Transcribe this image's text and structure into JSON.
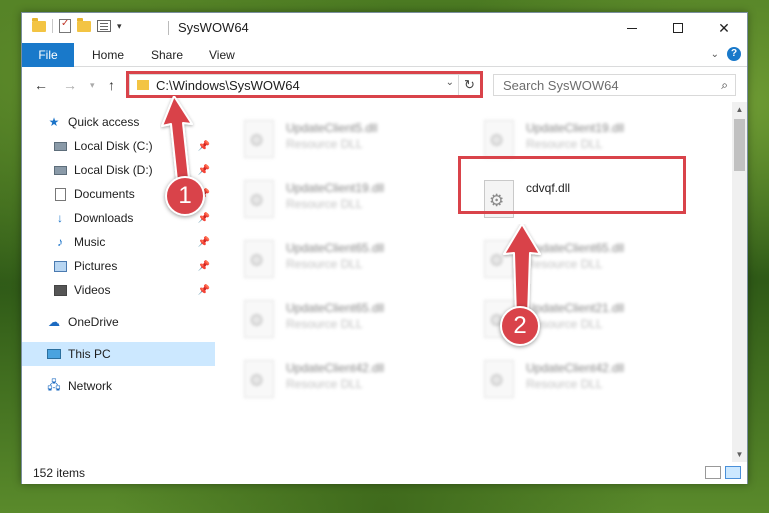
{
  "window": {
    "title": "SysWOW64",
    "controls": {
      "minimize": "",
      "maximize": "",
      "close": "✕"
    }
  },
  "ribbon": {
    "tabs": [
      {
        "label": "File"
      },
      {
        "label": "Home"
      },
      {
        "label": "Share"
      },
      {
        "label": "View"
      }
    ],
    "help_label": "?"
  },
  "address_bar": {
    "path": "C:\\Windows\\SysWOW64",
    "refresh_icon": "↻"
  },
  "search": {
    "placeholder": "Search SysWOW64"
  },
  "nav_pane": {
    "items": [
      {
        "label": "Quick access",
        "icon": "star-icon",
        "pinned": false
      },
      {
        "label": "Local Disk (C:)",
        "icon": "drive-icon",
        "pinned": true
      },
      {
        "label": "Local Disk (D:)",
        "icon": "drive-icon",
        "pinned": true
      },
      {
        "label": "Documents",
        "icon": "documents-icon",
        "pinned": true
      },
      {
        "label": "Downloads",
        "icon": "download-icon",
        "pinned": true
      },
      {
        "label": "Music",
        "icon": "music-icon",
        "pinned": true
      },
      {
        "label": "Pictures",
        "icon": "pictures-icon",
        "pinned": true
      },
      {
        "label": "Videos",
        "icon": "videos-icon",
        "pinned": true
      },
      {
        "label": "OneDrive",
        "icon": "cloud-icon",
        "pinned": false
      },
      {
        "label": "This PC",
        "icon": "pc-icon",
        "pinned": false,
        "selected": true
      },
      {
        "label": "Network",
        "icon": "network-icon",
        "pinned": false
      }
    ]
  },
  "files": [
    {
      "name": "UpdateClient5.dll",
      "type": "Resource DLL"
    },
    {
      "name": "UpdateClient19.dll",
      "type": "Resource DLL"
    },
    {
      "name": "UpdateClient19.dll",
      "type": "Resource DLL"
    },
    {
      "name": "cdvqf.dll",
      "type": ""
    },
    {
      "name": "UpdateClient65.dll",
      "type": "Resource DLL"
    },
    {
      "name": "UpdateClient65.dll",
      "type": "Resource DLL"
    },
    {
      "name": "UpdateClient65.dll",
      "type": "Resource DLL"
    },
    {
      "name": "UpdateClient21.dll",
      "type": "Resource DLL"
    },
    {
      "name": "UpdateClient42.dll",
      "type": "Resource DLL"
    },
    {
      "name": "UpdateClient42.dll",
      "type": "Resource DLL"
    }
  ],
  "status_bar": {
    "item_count": "152 items"
  },
  "annotations": {
    "step1": "1",
    "step2": "2",
    "accent_color": "#d9434a"
  },
  "colors": {
    "file_tab": "#1979ca",
    "selected_nav": "#cce8ff"
  }
}
